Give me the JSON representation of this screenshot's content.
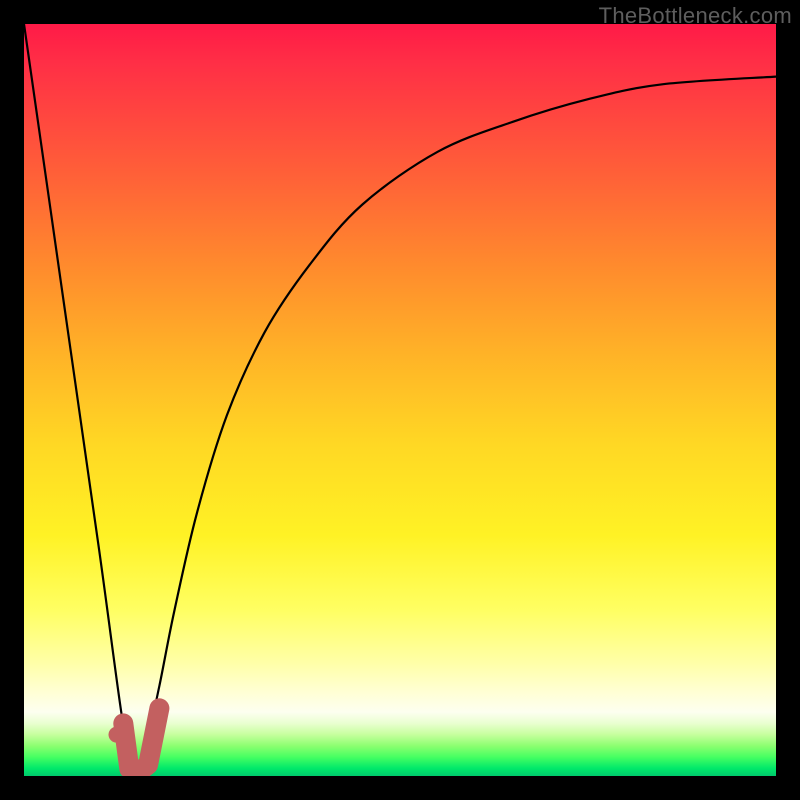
{
  "watermark": "TheBottleneck.com",
  "colors": {
    "page_bg": "#000000",
    "curve_stroke": "#000000",
    "marker_stroke": "#c36060",
    "gradient_stops": [
      "#ff1a47",
      "#ff2e46",
      "#ff6038",
      "#ff8a2d",
      "#ffb327",
      "#ffd824",
      "#fff225",
      "#ffff63",
      "#ffffa8",
      "#ffffd6",
      "#fdfff0",
      "#e9ffd0",
      "#c6ff9e",
      "#8cff70",
      "#45ff62",
      "#00e86a",
      "#00c96c"
    ]
  },
  "chart_data": {
    "type": "line",
    "title": "",
    "xlabel": "",
    "ylabel": "",
    "x": [
      0.0,
      0.05,
      0.1,
      0.13,
      0.145,
      0.16,
      0.18,
      0.2,
      0.23,
      0.27,
      0.32,
      0.38,
      0.45,
      0.55,
      0.65,
      0.75,
      0.85,
      1.0
    ],
    "values": [
      1.0,
      0.65,
      0.3,
      0.08,
      0.0,
      0.03,
      0.12,
      0.22,
      0.35,
      0.48,
      0.59,
      0.68,
      0.76,
      0.83,
      0.87,
      0.9,
      0.92,
      0.93
    ],
    "x_range": [
      0,
      1
    ],
    "y_range": [
      0,
      1
    ],
    "min_point": {
      "x": 0.145,
      "y": 0.0
    },
    "marker": {
      "path_x": [
        0.132,
        0.14,
        0.152,
        0.165,
        0.18
      ],
      "path_y": [
        0.07,
        0.01,
        0.005,
        0.015,
        0.09
      ],
      "dot": {
        "x": 0.123,
        "y": 0.055
      }
    }
  }
}
